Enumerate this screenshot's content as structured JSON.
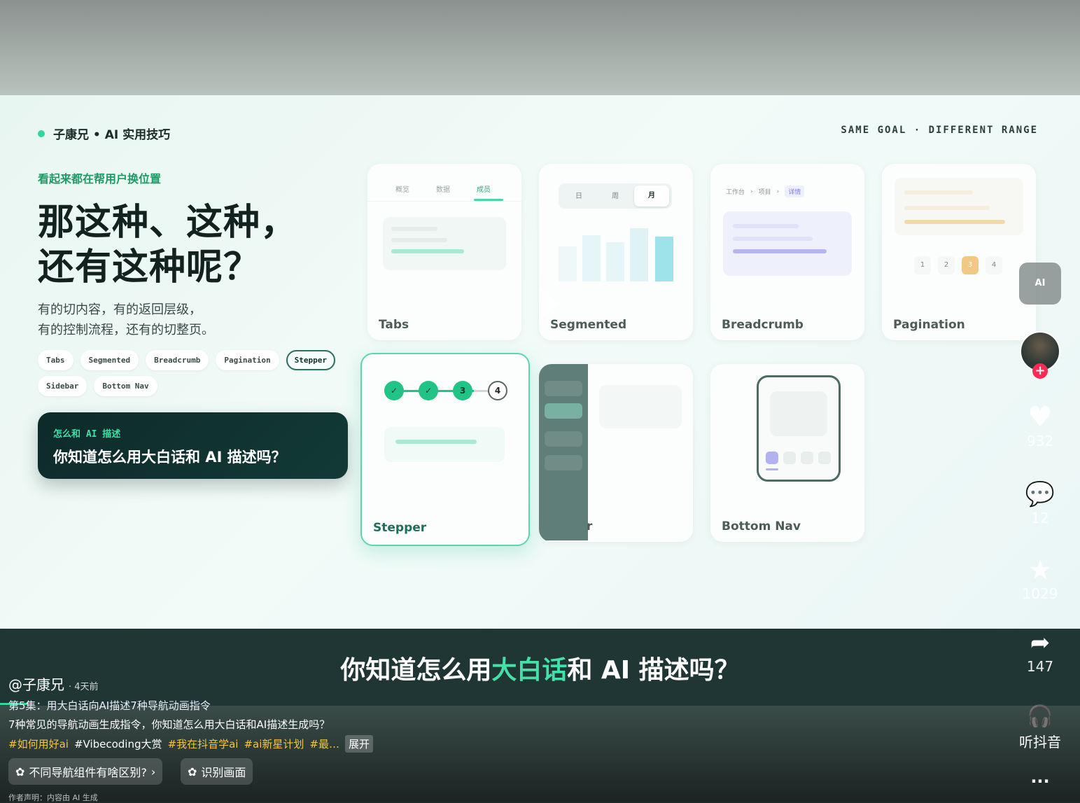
{
  "slide": {
    "brand": "子康兄 • AI 实用技巧",
    "tagline": "SAME GOAL · DIFFERENT RANGE",
    "eyebrow": "看起来都在帮用户换位置",
    "headline_line1": "那这种、这种，",
    "headline_line2": "还有这种呢？",
    "desc_line1": "有的切内容，有的返回层级，",
    "desc_line2": "有的控制流程，还有的切整页。",
    "chips": [
      "Tabs",
      "Segmented",
      "Breadcrumb",
      "Pagination",
      "Stepper",
      "Sidebar",
      "Bottom Nav"
    ],
    "active_chip": "Stepper",
    "question_label": "怎么和 AI 描述",
    "question_text": "你知道怎么用大白话和 AI 描述吗？",
    "cards": {
      "tabs": {
        "label": "Tabs",
        "items": [
          "概览",
          "数据",
          "成员"
        ]
      },
      "segmented": {
        "label": "Segmented",
        "items": [
          "日",
          "周",
          "月"
        ]
      },
      "breadcrumb": {
        "label": "Breadcrumb",
        "items": [
          "工作台",
          "项目",
          "详情"
        ],
        "separator": "›"
      },
      "pagination": {
        "label": "Pagination",
        "pages": [
          "1",
          "2",
          "3",
          "4"
        ],
        "current": 3
      },
      "stepper": {
        "label": "Stepper",
        "steps": [
          "✓",
          "✓",
          "3",
          "4"
        ]
      },
      "sidebar": {
        "label": "r"
      },
      "bottom_nav": {
        "label": "Bottom Nav"
      }
    }
  },
  "caption": {
    "before": "你知道怎么用",
    "highlight": "大白话",
    "after": "和 AI 描述吗？"
  },
  "post": {
    "author": "@子康兄",
    "ago": "· 4天前",
    "title": "第5集：用大白话向AI描述7种导航动画指令",
    "body": "7种常见的导航动画生成指令，你知道怎么用大白话和AI描述生成吗？",
    "tags": [
      "#如何用好ai",
      "#Vibecoding大赏",
      "#我在抖音学ai",
      "#ai新星计划",
      "#最…"
    ],
    "expand": "展开",
    "pill_question": "不同导航组件有啥区别?",
    "pill_recognize": "识别画面",
    "disclaimer": "作者声明：内容由 AI 生成"
  },
  "rail": {
    "ai_label": "AI",
    "likes": "932",
    "comments": "12",
    "favorites": "1029",
    "shares": "147",
    "listen": "听抖音",
    "more": "..."
  },
  "colors": {
    "accent": "#2fd79a",
    "caption_highlight": "#43e0a8",
    "tag": "#f3c53f",
    "follow": "#fe2c55"
  },
  "progress": 0.026
}
